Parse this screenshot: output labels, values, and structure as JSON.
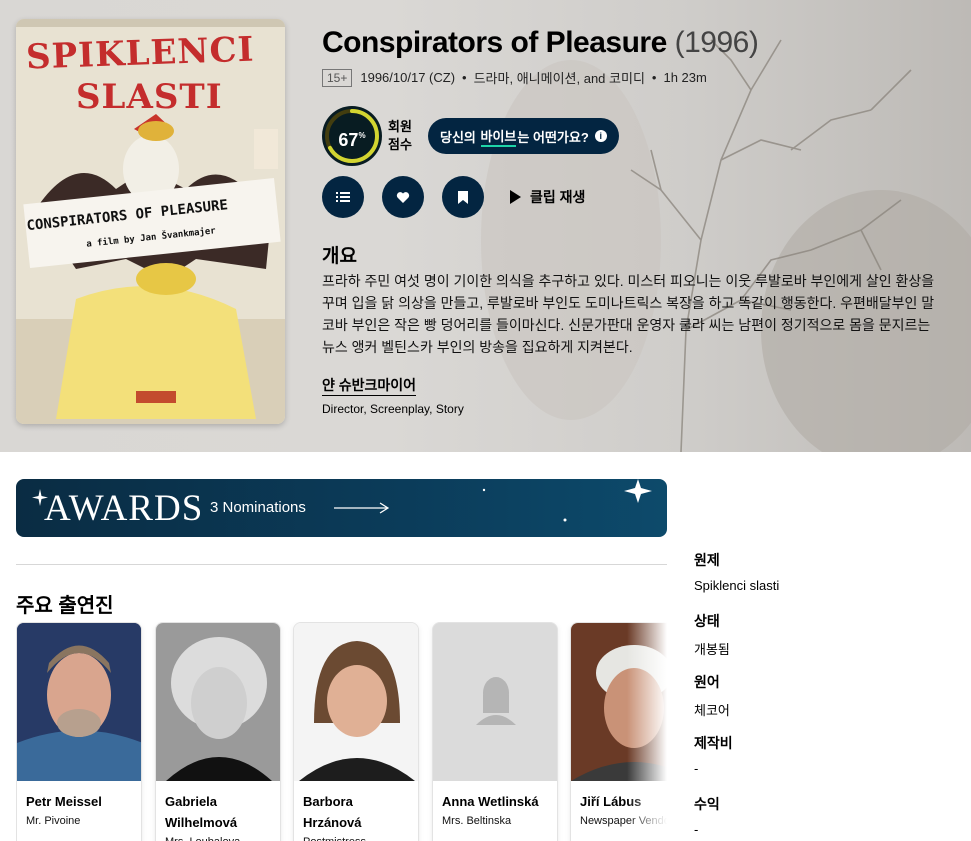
{
  "movie": {
    "title": "Conspirators of Pleasure",
    "year": "(1996)",
    "certification": "15+",
    "release": "1996/10/17 (CZ)",
    "genres": "드라마, 애니메이션, and 코미디",
    "runtime": "1h 23m"
  },
  "score": {
    "value": "67",
    "percent_symbol": "%",
    "label": "회원 점수",
    "level": 0.67,
    "ring_color": "#d2d531"
  },
  "vibe": {
    "prefix": "당신의 ",
    "highlight": "바이브",
    "suffix": "는 어떤가요?"
  },
  "actions": {
    "list_icon": "list-icon",
    "favorite_icon": "heart-icon",
    "watchlist_icon": "bookmark-icon",
    "play_label": "클립 재생"
  },
  "overview": {
    "heading": "개요",
    "text": "프라하 주민 여섯 명이 기이한 의식을 추구하고 있다. 미스터 피오니는 이웃 루발로바 부인에게 살인 환상을 꾸며 입을 닭 의상을 만들고, 루발로바 부인도 도미나트릭스 복장을 하고 똑같이 행동한다. 우편배달부인 말코바 부인은 작은 빵 덩어리를 들이마신다. 신문가판대 운영자 쿨라 씨는 남편이 정기적으로 몸을 문지르는 뉴스 앵커 벨틴스카 부인의 방송을 집요하게 지켜본다."
  },
  "crew": {
    "name": "얀 슈반크마이어",
    "role": "Director, Screenplay, Story"
  },
  "poster": {
    "top_title_1": "SPIKLENCI",
    "top_title_2": "SLASTI",
    "banner": "CONSPIRATORS OF PLEASURE",
    "byline": "a film by Jan Švankmajer"
  },
  "awards": {
    "word": "AWARDS",
    "count": "3 Nominations",
    "color": "#0b3c5a"
  },
  "cast": {
    "heading": "주요 출연진",
    "members": [
      {
        "name": "Petr Meissel",
        "character": "Mr. Pivoine"
      },
      {
        "name": "Gabriela Wilhelmová",
        "character": "Mrs. Loubalova"
      },
      {
        "name": "Barbora Hrzánová",
        "character": "Postmistress"
      },
      {
        "name": "Anna Wetlinská",
        "character": "Mrs. Beltinska"
      },
      {
        "name": "Jiří Lábus",
        "character": "Newspaper Vendor"
      }
    ]
  },
  "facts": [
    {
      "label": "원제",
      "value": "Spiklenci slasti"
    },
    {
      "label": "상태",
      "value": "개봉됨"
    },
    {
      "label": "원어",
      "value": "체코어"
    },
    {
      "label": "제작비",
      "value": "-"
    },
    {
      "label": "수익",
      "value": "-"
    }
  ]
}
